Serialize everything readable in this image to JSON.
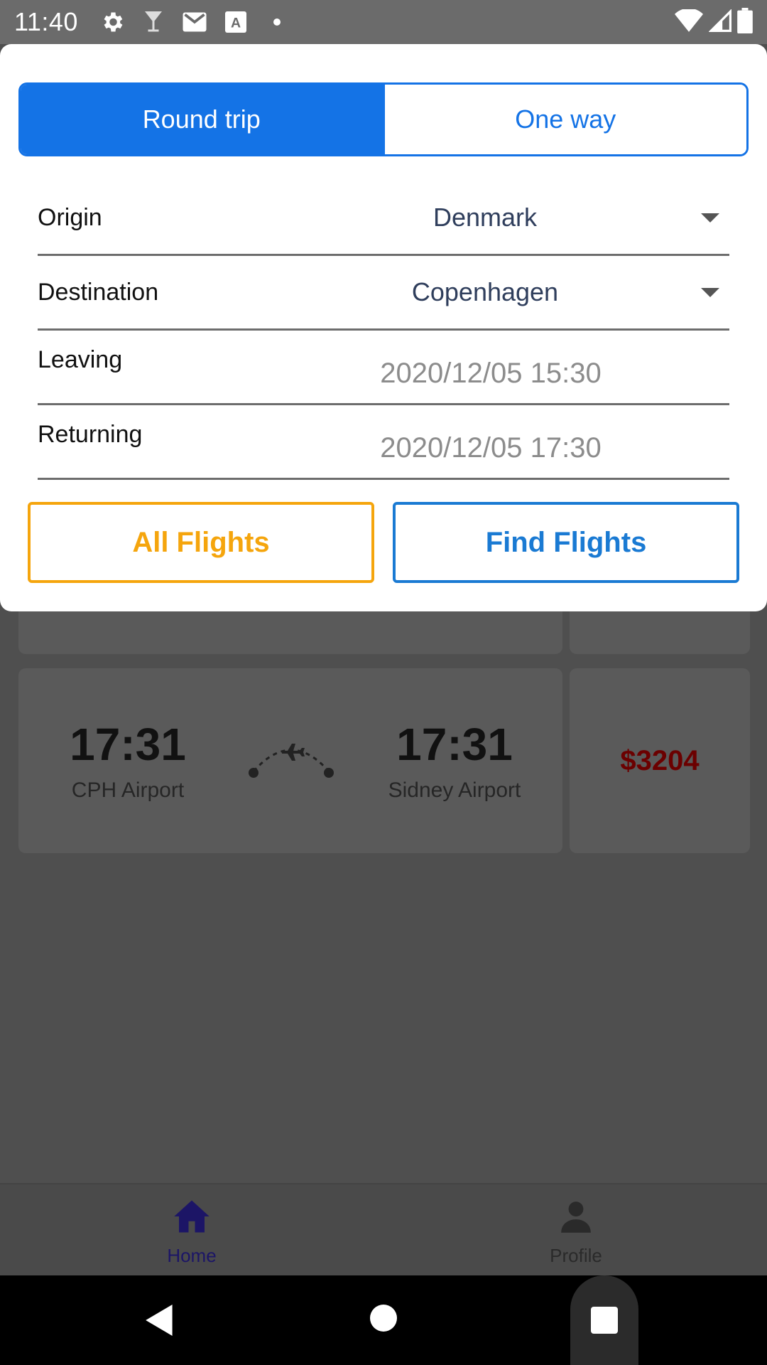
{
  "status_bar": {
    "time": "11:40",
    "icons": [
      "gear-icon",
      "drink-icon",
      "mail-icon",
      "font-icon",
      "dot-icon"
    ],
    "right_icons": [
      "wifi-icon",
      "signal-icon",
      "battery-icon"
    ]
  },
  "modal": {
    "trip_type": {
      "round_trip_label": "Round trip",
      "one_way_label": "One way",
      "selected": "Round trip"
    },
    "origin": {
      "label": "Origin",
      "value": "Denmark"
    },
    "destination": {
      "label": "Destination",
      "value": "Copenhagen"
    },
    "leaving": {
      "label": "Leaving",
      "value": "2020/12/05 15:30"
    },
    "returning": {
      "label": "Returning",
      "value": "2020/12/05 17:30"
    },
    "all_flights_label": "All Flights",
    "find_flights_label": "Find Flights"
  },
  "flight": {
    "departure_time": "17:31",
    "departure_airport": "CPH Airport",
    "arrival_time": "17:31",
    "arrival_airport": "Sidney Airport",
    "price": "$3204"
  },
  "bottom_nav": {
    "home_label": "Home",
    "profile_label": "Profile"
  },
  "colors": {
    "primary_blue": "#1473e6",
    "accent_orange": "#f5a50d",
    "price_red": "#6b0000",
    "home_active": "#1c1566"
  }
}
